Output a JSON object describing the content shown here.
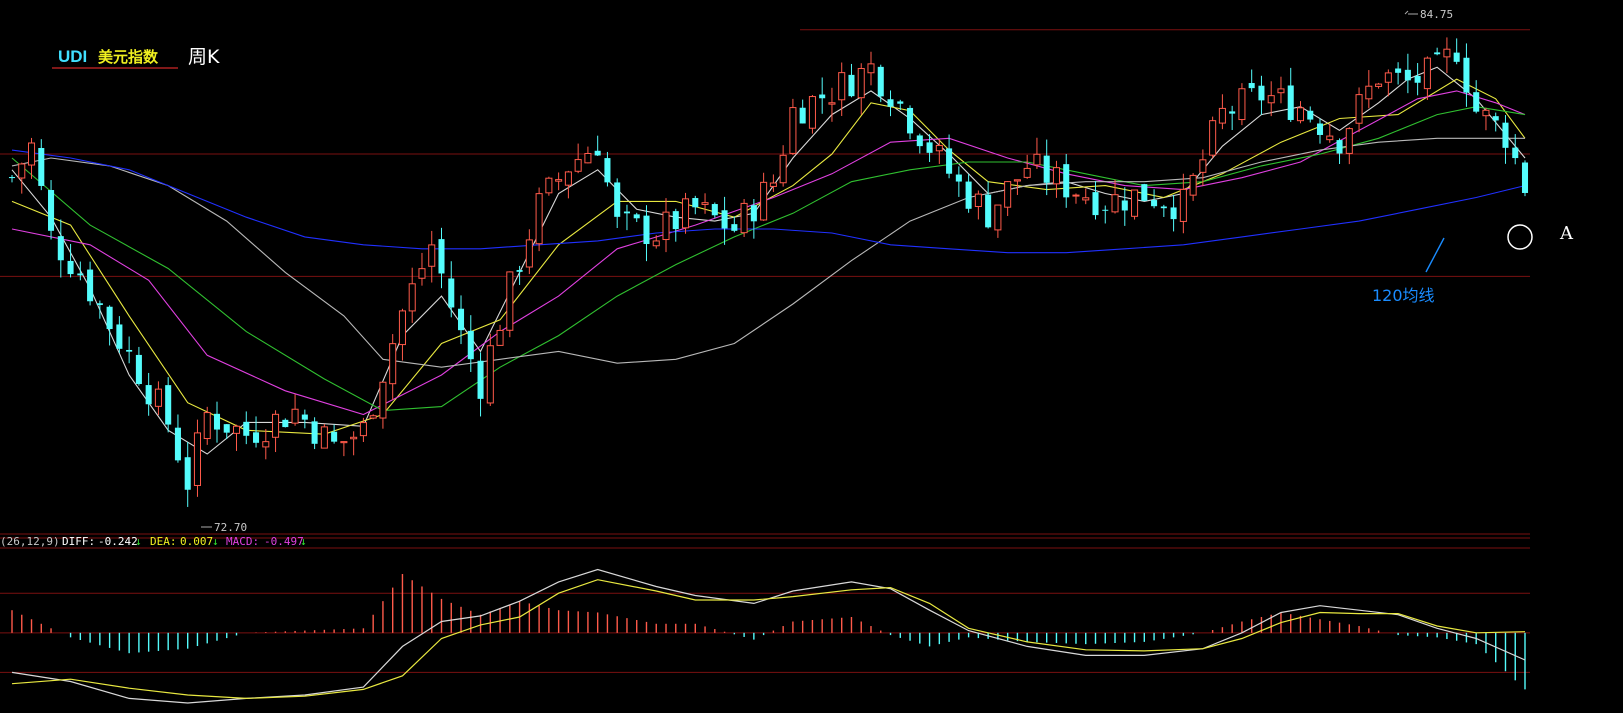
{
  "header": {
    "symbol": "UDI",
    "name": "美元指数",
    "period": "周K"
  },
  "annotations": {
    "high_label": "84.75",
    "low_label": "72.70",
    "ma120_label": "120均线",
    "point_label": "A"
  },
  "macd_header": {
    "params": "(26,12,9)",
    "diff_label": "DIFF:",
    "diff_value": "-0.242",
    "dea_label": "DEA:",
    "dea_value": "0.007",
    "macd_label": "MACD:",
    "macd_value": "-0.497",
    "arrow": "↓"
  },
  "colors": {
    "background": "#000000",
    "up": "#ff5a4a",
    "down": "#54fcfc",
    "grid": "#7a1010",
    "ma_white": "#d8d8d8",
    "ma_yellow": "#e8e840",
    "ma_magenta": "#e040e0",
    "ma_green": "#30c030",
    "ma_gray": "#b8b8b8",
    "ma_blue": "#2030ff",
    "annotation_blue": "#1a8cff",
    "header_yellow": "#f0f020",
    "header_cyan": "#40e0ff"
  },
  "chart_data": {
    "type": "candlestick",
    "title": "UDI 美元指数 周K",
    "y_range": [
      72.2,
      85.2
    ],
    "price_levels": [
      84.75,
      81.6,
      78.5
    ],
    "high": 84.75,
    "low": 72.7,
    "candle_count": 156,
    "price_path": [
      [
        0,
        81.0
      ],
      [
        2,
        81.8
      ],
      [
        4,
        79.5
      ],
      [
        7,
        78.6
      ],
      [
        10,
        77.3
      ],
      [
        13,
        76.1
      ],
      [
        16,
        74.8
      ],
      [
        18,
        73.3
      ],
      [
        20,
        75.0
      ],
      [
        24,
        74.5
      ],
      [
        29,
        75.1
      ],
      [
        33,
        74.2
      ],
      [
        36,
        74.6
      ],
      [
        40,
        77.6
      ],
      [
        43,
        79.3
      ],
      [
        46,
        77.0
      ],
      [
        48,
        75.8
      ],
      [
        51,
        78.2
      ],
      [
        54,
        80.3
      ],
      [
        57,
        81.3
      ],
      [
        60,
        81.9
      ],
      [
        62,
        79.8
      ],
      [
        66,
        79.6
      ],
      [
        70,
        80.2
      ],
      [
        74,
        79.7
      ],
      [
        78,
        80.9
      ],
      [
        80,
        82.7
      ],
      [
        84,
        83.2
      ],
      [
        88,
        83.8
      ],
      [
        90,
        83.2
      ],
      [
        94,
        81.8
      ],
      [
        97,
        80.8
      ],
      [
        100,
        80.1
      ],
      [
        104,
        81.3
      ],
      [
        108,
        80.8
      ],
      [
        112,
        80.4
      ],
      [
        116,
        80.6
      ],
      [
        120,
        80.3
      ],
      [
        124,
        82.6
      ],
      [
        128,
        83.1
      ],
      [
        132,
        82.8
      ],
      [
        136,
        82.0
      ],
      [
        140,
        83.6
      ],
      [
        143,
        83.4
      ],
      [
        146,
        83.7
      ],
      [
        148,
        84.3
      ],
      [
        150,
        82.7
      ],
      [
        153,
        82.1
      ],
      [
        155,
        80.8
      ]
    ],
    "ma_lines": [
      {
        "color_key": "ma_white",
        "points": [
          [
            0,
            81.2
          ],
          [
            4,
            80.0
          ],
          [
            8,
            78.2
          ],
          [
            12,
            76.0
          ],
          [
            16,
            74.6
          ],
          [
            20,
            74.0
          ],
          [
            24,
            74.8
          ],
          [
            30,
            74.8
          ],
          [
            36,
            74.7
          ],
          [
            40,
            77.0
          ],
          [
            44,
            78.0
          ],
          [
            48,
            76.6
          ],
          [
            52,
            78.6
          ],
          [
            56,
            80.6
          ],
          [
            60,
            81.2
          ],
          [
            64,
            80.2
          ],
          [
            68,
            80.0
          ],
          [
            72,
            79.9
          ],
          [
            76,
            80.1
          ],
          [
            80,
            81.5
          ],
          [
            84,
            82.6
          ],
          [
            88,
            83.2
          ],
          [
            92,
            82.5
          ],
          [
            96,
            81.6
          ],
          [
            100,
            80.6
          ],
          [
            104,
            80.8
          ],
          [
            108,
            80.9
          ],
          [
            112,
            80.6
          ],
          [
            116,
            80.4
          ],
          [
            120,
            80.6
          ],
          [
            124,
            81.8
          ],
          [
            128,
            82.6
          ],
          [
            132,
            82.8
          ],
          [
            136,
            82.2
          ],
          [
            140,
            82.9
          ],
          [
            143,
            83.5
          ],
          [
            146,
            83.8
          ],
          [
            150,
            83.0
          ],
          [
            155,
            81.5
          ]
        ]
      },
      {
        "color_key": "ma_yellow",
        "points": [
          [
            0,
            80.4
          ],
          [
            6,
            79.8
          ],
          [
            12,
            77.5
          ],
          [
            18,
            75.3
          ],
          [
            24,
            74.6
          ],
          [
            32,
            74.5
          ],
          [
            38,
            75.0
          ],
          [
            44,
            76.8
          ],
          [
            50,
            77.4
          ],
          [
            56,
            79.3
          ],
          [
            62,
            80.4
          ],
          [
            68,
            80.4
          ],
          [
            74,
            80.0
          ],
          [
            80,
            80.8
          ],
          [
            84,
            81.6
          ],
          [
            88,
            82.9
          ],
          [
            92,
            82.7
          ],
          [
            96,
            81.7
          ],
          [
            100,
            80.9
          ],
          [
            106,
            80.7
          ],
          [
            112,
            80.8
          ],
          [
            118,
            80.5
          ],
          [
            124,
            81.1
          ],
          [
            130,
            81.9
          ],
          [
            136,
            82.5
          ],
          [
            142,
            82.6
          ],
          [
            148,
            83.5
          ],
          [
            152,
            83.0
          ],
          [
            155,
            82.0
          ]
        ]
      },
      {
        "color_key": "ma_magenta",
        "points": [
          [
            0,
            79.7
          ],
          [
            8,
            79.3
          ],
          [
            14,
            78.4
          ],
          [
            20,
            76.5
          ],
          [
            28,
            75.6
          ],
          [
            36,
            75.0
          ],
          [
            44,
            76.0
          ],
          [
            50,
            77.1
          ],
          [
            56,
            78.0
          ],
          [
            62,
            79.2
          ],
          [
            70,
            79.8
          ],
          [
            78,
            80.5
          ],
          [
            84,
            81.1
          ],
          [
            90,
            81.9
          ],
          [
            96,
            82.0
          ],
          [
            102,
            81.5
          ],
          [
            108,
            81.1
          ],
          [
            114,
            80.8
          ],
          [
            120,
            80.7
          ],
          [
            126,
            81.0
          ],
          [
            132,
            81.4
          ],
          [
            138,
            82.2
          ],
          [
            144,
            83.0
          ],
          [
            148,
            83.2
          ],
          [
            152,
            82.9
          ],
          [
            155,
            82.6
          ]
        ]
      },
      {
        "color_key": "ma_green",
        "points": [
          [
            0,
            81.5
          ],
          [
            8,
            79.8
          ],
          [
            16,
            78.7
          ],
          [
            24,
            77.1
          ],
          [
            32,
            75.9
          ],
          [
            38,
            75.1
          ],
          [
            44,
            75.2
          ],
          [
            50,
            76.2
          ],
          [
            56,
            77.0
          ],
          [
            62,
            78.0
          ],
          [
            68,
            78.8
          ],
          [
            74,
            79.5
          ],
          [
            80,
            80.1
          ],
          [
            86,
            80.9
          ],
          [
            92,
            81.2
          ],
          [
            98,
            81.4
          ],
          [
            104,
            81.4
          ],
          [
            110,
            81.1
          ],
          [
            116,
            80.8
          ],
          [
            122,
            80.9
          ],
          [
            128,
            81.3
          ],
          [
            134,
            81.6
          ],
          [
            140,
            82.0
          ],
          [
            146,
            82.6
          ],
          [
            150,
            82.8
          ],
          [
            155,
            82.6
          ]
        ]
      },
      {
        "color_key": "ma_gray",
        "points": [
          [
            0,
            81.3
          ],
          [
            4,
            81.5
          ],
          [
            10,
            81.3
          ],
          [
            16,
            80.8
          ],
          [
            22,
            79.9
          ],
          [
            28,
            78.6
          ],
          [
            34,
            77.5
          ],
          [
            38,
            76.4
          ],
          [
            44,
            76.2
          ],
          [
            50,
            76.4
          ],
          [
            56,
            76.6
          ],
          [
            62,
            76.3
          ],
          [
            68,
            76.4
          ],
          [
            74,
            76.8
          ],
          [
            80,
            77.8
          ],
          [
            86,
            78.9
          ],
          [
            92,
            79.9
          ],
          [
            98,
            80.5
          ],
          [
            104,
            80.8
          ],
          [
            110,
            80.9
          ],
          [
            116,
            80.9
          ],
          [
            122,
            81.0
          ],
          [
            128,
            81.4
          ],
          [
            134,
            81.7
          ],
          [
            140,
            81.9
          ],
          [
            146,
            82.0
          ],
          [
            150,
            82.0
          ],
          [
            155,
            82.0
          ]
        ]
      },
      {
        "color_key": "ma_blue",
        "points": [
          [
            0,
            81.7
          ],
          [
            6,
            81.5
          ],
          [
            12,
            81.2
          ],
          [
            18,
            80.6
          ],
          [
            24,
            80.0
          ],
          [
            30,
            79.5
          ],
          [
            36,
            79.3
          ],
          [
            42,
            79.2
          ],
          [
            48,
            79.2
          ],
          [
            54,
            79.3
          ],
          [
            60,
            79.4
          ],
          [
            66,
            79.6
          ],
          [
            72,
            79.7
          ],
          [
            78,
            79.7
          ],
          [
            84,
            79.6
          ],
          [
            90,
            79.3
          ],
          [
            96,
            79.2
          ],
          [
            102,
            79.1
          ],
          [
            108,
            79.1
          ],
          [
            114,
            79.2
          ],
          [
            120,
            79.3
          ],
          [
            126,
            79.5
          ],
          [
            132,
            79.7
          ],
          [
            138,
            79.9
          ],
          [
            144,
            80.2
          ],
          [
            150,
            80.5
          ],
          [
            155,
            80.8
          ]
        ]
      }
    ],
    "macd": {
      "y_range": [
        -0.7,
        0.75
      ],
      "diff": [
        [
          0,
          -0.35
        ],
        [
          6,
          -0.43
        ],
        [
          12,
          -0.58
        ],
        [
          18,
          -0.62
        ],
        [
          24,
          -0.58
        ],
        [
          30,
          -0.55
        ],
        [
          36,
          -0.48
        ],
        [
          40,
          -0.12
        ],
        [
          44,
          0.1
        ],
        [
          48,
          0.15
        ],
        [
          52,
          0.28
        ],
        [
          56,
          0.45
        ],
        [
          60,
          0.56
        ],
        [
          66,
          0.41
        ],
        [
          70,
          0.33
        ],
        [
          76,
          0.26
        ],
        [
          80,
          0.37
        ],
        [
          86,
          0.45
        ],
        [
          90,
          0.39
        ],
        [
          94,
          0.2
        ],
        [
          98,
          0.02
        ],
        [
          104,
          -0.12
        ],
        [
          110,
          -0.2
        ],
        [
          116,
          -0.2
        ],
        [
          122,
          -0.14
        ],
        [
          126,
          0.0
        ],
        [
          130,
          0.18
        ],
        [
          134,
          0.24
        ],
        [
          138,
          0.2
        ],
        [
          142,
          0.16
        ],
        [
          146,
          0.04
        ],
        [
          150,
          -0.05
        ],
        [
          155,
          -0.24
        ]
      ],
      "dea": [
        [
          0,
          -0.45
        ],
        [
          6,
          -0.41
        ],
        [
          12,
          -0.49
        ],
        [
          18,
          -0.55
        ],
        [
          24,
          -0.58
        ],
        [
          30,
          -0.56
        ],
        [
          36,
          -0.5
        ],
        [
          40,
          -0.38
        ],
        [
          44,
          -0.05
        ],
        [
          48,
          0.07
        ],
        [
          52,
          0.14
        ],
        [
          56,
          0.35
        ],
        [
          60,
          0.47
        ],
        [
          66,
          0.37
        ],
        [
          70,
          0.29
        ],
        [
          76,
          0.29
        ],
        [
          80,
          0.32
        ],
        [
          86,
          0.38
        ],
        [
          90,
          0.4
        ],
        [
          94,
          0.26
        ],
        [
          98,
          0.04
        ],
        [
          104,
          -0.08
        ],
        [
          110,
          -0.15
        ],
        [
          116,
          -0.16
        ],
        [
          122,
          -0.14
        ],
        [
          126,
          -0.05
        ],
        [
          130,
          0.09
        ],
        [
          134,
          0.18
        ],
        [
          138,
          0.17
        ],
        [
          142,
          0.17
        ],
        [
          146,
          0.06
        ],
        [
          150,
          0.0
        ],
        [
          155,
          0.01
        ]
      ],
      "diff_value": -0.242,
      "dea_value": 0.007,
      "macd_value": -0.497
    }
  }
}
